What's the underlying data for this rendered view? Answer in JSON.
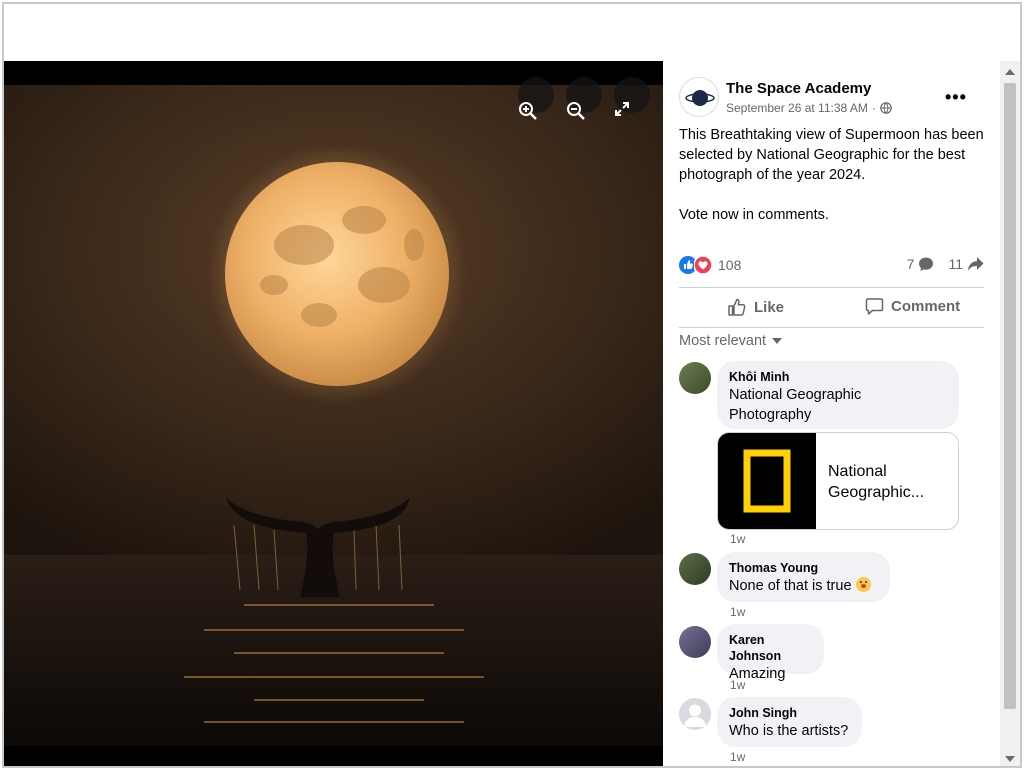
{
  "photo": {
    "zoom_in_icon": "zoom-in-icon",
    "zoom_out_icon": "zoom-out-icon",
    "fullscreen_icon": "fullscreen-icon",
    "alt": "Supermoon over ocean with whale tail"
  },
  "post": {
    "page_name": "The Space Academy",
    "timestamp": "September 26 at 11:38 AM",
    "separator": "·",
    "text_p1": "This Breathtaking view of Supermoon has been selected by National Geographic for the best photograph of the year 2024.",
    "text_p2": "Vote now in comments.",
    "reaction_count": "108",
    "comment_count": "7",
    "share_count": "11",
    "like_label": "Like",
    "comment_label": "Comment",
    "sort_label": "Most relevant"
  },
  "comments": [
    {
      "name": "Khôi Minh",
      "text_line1": "National Geographic",
      "text_line2": "Photography",
      "time": "1w"
    },
    {
      "name": "Thomas Young",
      "text": "None of that is true",
      "time": "1w"
    },
    {
      "name": "Karen Johnson",
      "text": "Amazing",
      "time": "1w"
    },
    {
      "name": "John Singh",
      "text": "Who is the artists?",
      "time": "1w"
    }
  ],
  "link_card": {
    "title_line1": "National",
    "title_line2": "Geographic..."
  },
  "colors": {
    "accent": "#1877f2",
    "love": "#f33e58",
    "natgeo_yellow": "#ffd100"
  }
}
